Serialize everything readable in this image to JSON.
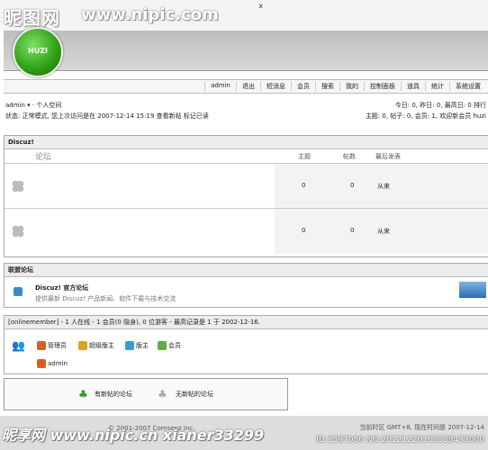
{
  "watermark": {
    "site_cn": "昵图网",
    "url": "www.nipic.com",
    "bottom": "昵享网 www.nipic.cn xianer33299"
  },
  "window": {
    "close": "x"
  },
  "logo": {
    "text": "HUZI"
  },
  "nav": {
    "items": [
      "admin",
      "退出",
      "短消息",
      "会员",
      "搜索",
      "我的",
      "控制面板",
      "道具",
      "统计",
      "系统设置"
    ]
  },
  "user": {
    "name": "admin",
    "space": "个人空间",
    "status": "状态: 正常模式, 您上次访问是在 2007-12-14 15:19",
    "link_new": "查看新帖",
    "link_read": "标记已读",
    "stats1": "今日: 0, 昨日: 0, 最高日: 0  排行",
    "stats2": "主题: 0, 帖子: 0, 会员: 1, 欢迎新会员 huzi"
  },
  "forum": {
    "title": "Discuz!",
    "col_name": "论坛",
    "col_topics": "主题",
    "col_posts": "帖数",
    "col_last": "最后发表",
    "rows": [
      {
        "topics": "0",
        "posts": "0",
        "last": "从来"
      },
      {
        "topics": "0",
        "posts": "0",
        "last": "从来"
      }
    ]
  },
  "links": {
    "title": "联盟论坛",
    "name": "Discuz! 官方论坛",
    "desc": "提供最新 Discuz! 产品新闻、软件下载与技术交流"
  },
  "online": {
    "title": "[onlinemember] - 1 人在线 - 1 会员(0 隐身), 0 位游客 - 最高记录是 1 于 2002-12-16.",
    "groups": [
      "管理员",
      "超级版主",
      "版主",
      "会员"
    ],
    "member": "admin"
  },
  "legend": {
    "new": "有新帖的论坛",
    "none": "无新帖的论坛"
  },
  "footer": {
    "copyright": "© 2001-2007 Comsenz Inc.",
    "time": "当前时区 GMT+8, 现在时间是 2007-12-14",
    "id": "ID:3597056 NO:20121220163538433000"
  },
  "colors": {
    "logo": "#2d9d12",
    "header": "#c8c8c8"
  }
}
